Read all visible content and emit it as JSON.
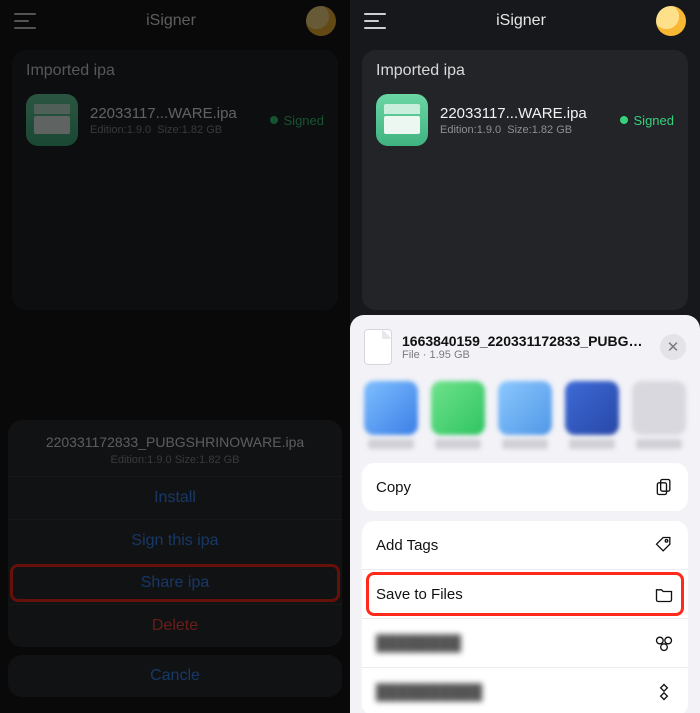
{
  "app": {
    "title": "iSigner"
  },
  "card": {
    "heading": "Imported ipa",
    "file_short": "22033117...WARE.ipa",
    "edition_label": "Edition:1.9.0",
    "size_label": "Size:1.82 GB",
    "status": "Signed"
  },
  "sheet": {
    "filename": "220331172833_PUBGSHRINOWARE.ipa",
    "meta": "Edition:1.9.0   Size:1.82 GB",
    "install": "Install",
    "sign": "Sign this ipa",
    "share": "Share ipa",
    "delete": "Delete",
    "cancel": "Cancle"
  },
  "share": {
    "title": "1663840159_220331172833_PUBGSH...",
    "meta": "File · 1.95 GB",
    "copy": "Copy",
    "add_tags": "Add Tags",
    "save_files": "Save to Files"
  }
}
